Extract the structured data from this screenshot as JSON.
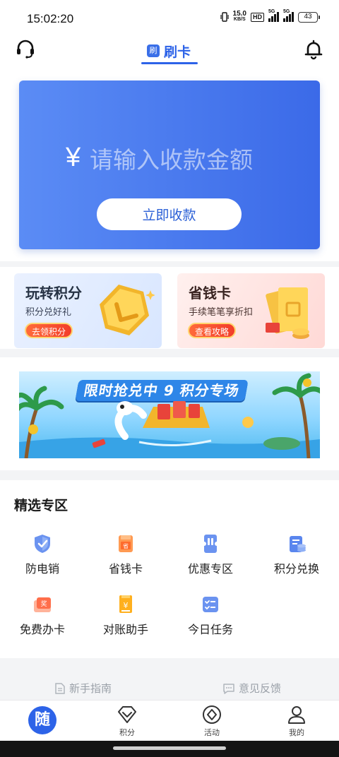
{
  "status_bar": {
    "time": "15:02:20",
    "net_speed": "15.0",
    "net_unit": "KB/S",
    "hd": "HD",
    "sig1": "5G",
    "sig2": "5G",
    "battery": "43"
  },
  "header": {
    "tab_badge": "刷",
    "tab_label": "刷卡",
    "left_icon": "headset-icon",
    "right_icon": "bell-icon",
    "accent": "#2d63e8"
  },
  "pay_card": {
    "currency": "¥",
    "amount_placeholder": "请输入收款金额",
    "collect_button": "立即收款",
    "gradient": [
      "#5b8cf5",
      "#3b6ae8"
    ]
  },
  "promos": [
    {
      "title": "玩转积分",
      "subtitle": "积分兑好礼",
      "pill": "去领积分"
    },
    {
      "title": "省钱卡",
      "subtitle": "手续笔笔享折扣",
      "pill": "查看攻略"
    }
  ],
  "banner": {
    "title": "限时抢兑中 9 积分专场"
  },
  "featured": {
    "title": "精选专区",
    "items": [
      {
        "label": "防电销",
        "icon": "shield-check-icon"
      },
      {
        "label": "省钱卡",
        "icon": "saving-card-icon"
      },
      {
        "label": "优惠专区",
        "icon": "coupon-icon"
      },
      {
        "label": "积分兑换",
        "icon": "points-exchange-icon"
      },
      {
        "label": "免费办卡",
        "icon": "free-card-icon"
      },
      {
        "label": "对账助手",
        "icon": "bill-icon"
      },
      {
        "label": "今日任务",
        "icon": "task-list-icon"
      }
    ]
  },
  "footer_links": [
    {
      "label": "新手指南",
      "icon": "document-icon"
    },
    {
      "label": "意见反馈",
      "icon": "feedback-icon"
    }
  ],
  "bottom_nav": [
    {
      "label": "",
      "glyph": "随",
      "icon": "home-logo-icon"
    },
    {
      "label": "积分",
      "icon": "diamond-icon"
    },
    {
      "label": "活动",
      "icon": "activity-icon"
    },
    {
      "label": "我的",
      "icon": "profile-icon"
    }
  ]
}
